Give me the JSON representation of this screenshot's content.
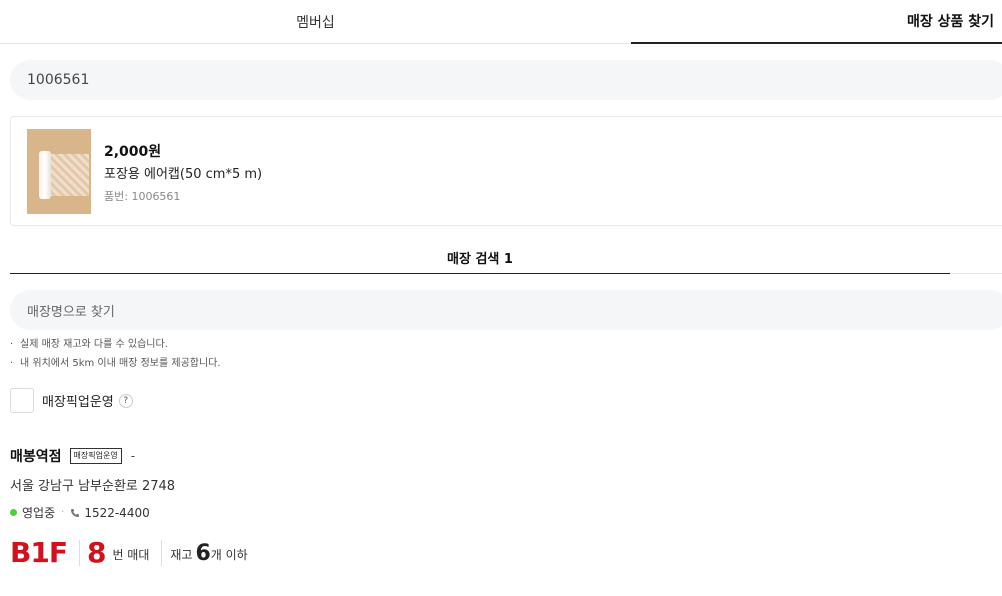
{
  "tabs": [
    {
      "label": "멤버십",
      "active": false
    },
    {
      "label": "매장 상품 찾기",
      "active": true
    }
  ],
  "search": {
    "value": "1006561"
  },
  "product": {
    "price": "2,000원",
    "name": "포장용 에어캡(50 cm*5 m)",
    "code": "품번: 1006561"
  },
  "store_search": {
    "tab_label": "매장 검색 1",
    "placeholder": "매장명으로 찾기"
  },
  "notes": [
    "실제 매장 재고와 다를 수 있습니다.",
    "내 위치에서 5km 이내 매장 정보를 제공합니다."
  ],
  "filter": {
    "label": "매장픽업운영",
    "help": "?"
  },
  "store": {
    "name": "매봉역점",
    "badge": "매장픽업운영",
    "dash": "-",
    "address": "서울 강남구 남부순환로 2748",
    "status": "영업중",
    "phone": "1522-4400",
    "floor": "B1F",
    "aisle": "8",
    "aisle_label": "번 매대",
    "stock_prefix": "재고",
    "stock_count": "6",
    "stock_suffix": "개 이하"
  },
  "colors": {
    "accent_red": "#d3101c",
    "open_green": "#4cd137"
  }
}
